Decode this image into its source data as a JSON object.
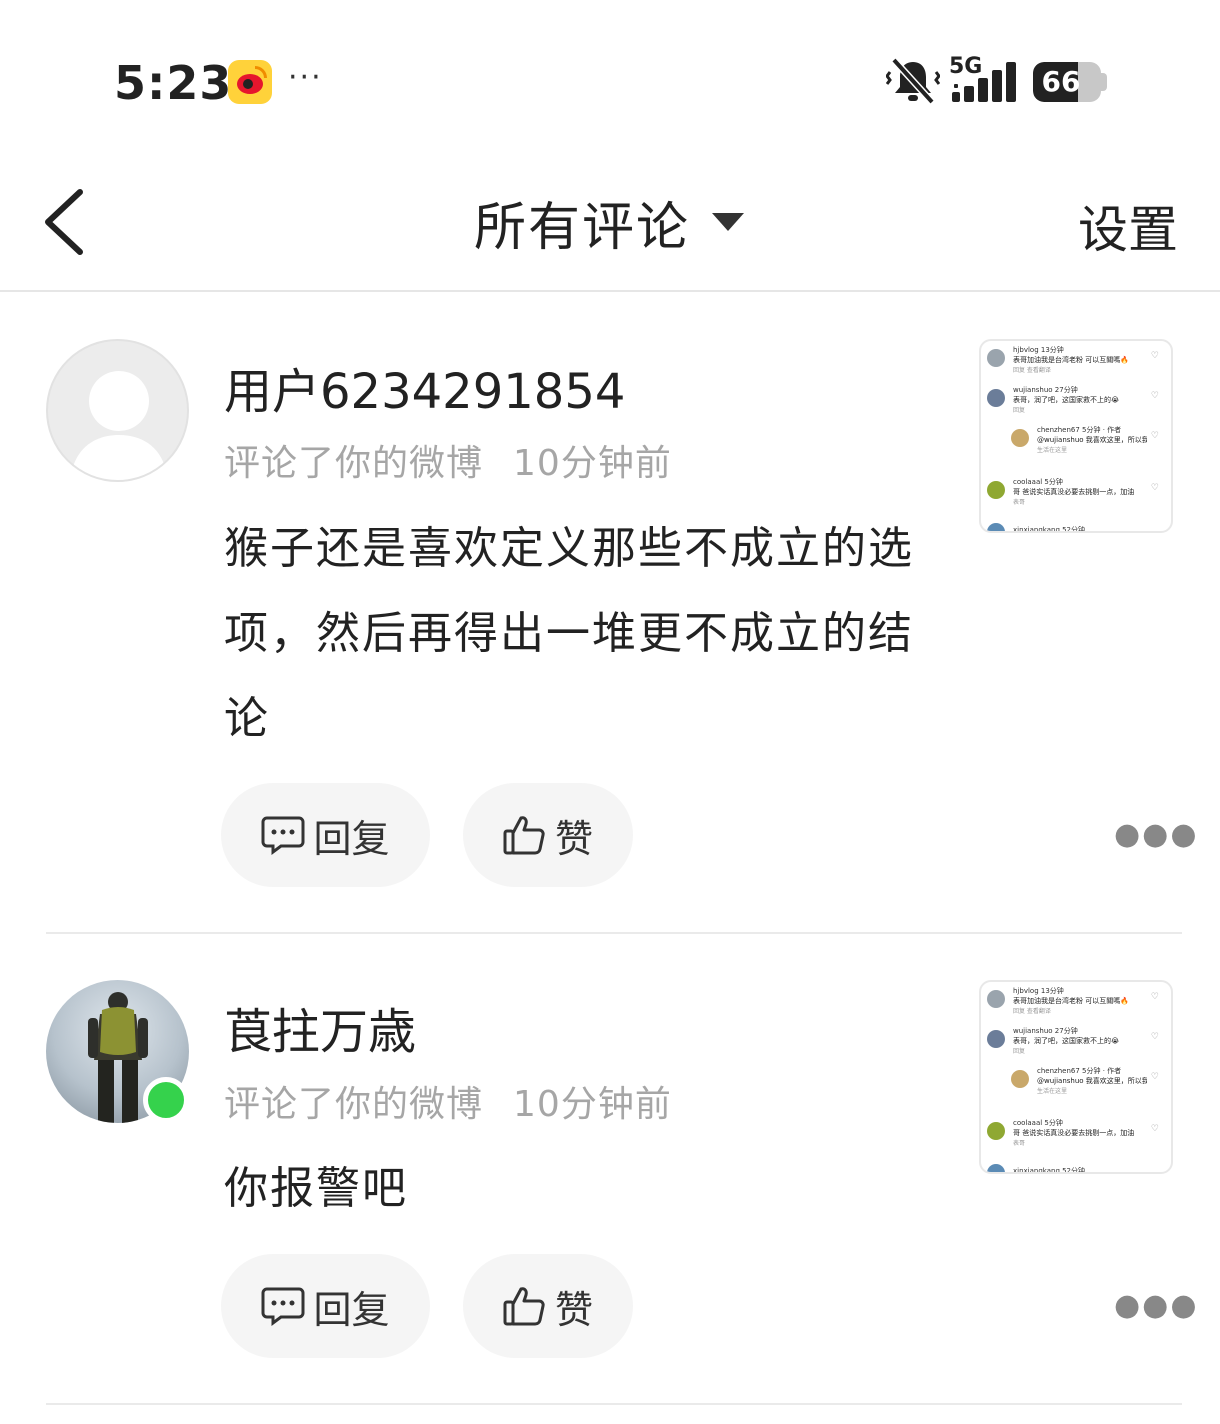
{
  "status_bar": {
    "time": "5:23",
    "more": "···",
    "network": "5G",
    "battery_level": 66,
    "battery_text": "66"
  },
  "nav": {
    "title": "所有评论",
    "settings": "设置"
  },
  "comments": [
    {
      "username": "用户6234291854",
      "action": "评论了你的微博",
      "time": "10分钟前",
      "text": "猴子还是喜欢定义那些不成立的选项，然后再得出一堆更不成立的结论",
      "reply_label": "回复",
      "like_label": "赞",
      "online": false
    },
    {
      "username": "莨拄万歳",
      "action": "评论了你的微博",
      "time": "10分钟前",
      "text": "你报警吧",
      "reply_label": "回复",
      "like_label": "赞",
      "online": true
    }
  ],
  "thumbnail": {
    "rows": [
      {
        "name": "hjbvlog  13分钟",
        "text": "表哥加油我是台湾老粉 可以互關嗎🔥",
        "sub": "回复    查看翻译",
        "reply": false
      },
      {
        "name": "wujianshuo  27分钟",
        "text": "表哥，润了吧，这国家救不上的😭",
        "sub": "回复",
        "reply": false
      },
      {
        "name": "chenzhen67  5分钟 · 作者",
        "text": "@wujianshuo 我喜欢这里，所以我",
        "sub": "生活在这里",
        "reply": true
      },
      {
        "name": "coolaaal  5分钟",
        "text": "哥 爸说实话真没必要去挑剔一点，加油",
        "sub": "表哥",
        "reply": false
      },
      {
        "name": "xinxiangkang  52分钟",
        "text": "",
        "sub": "",
        "reply": false
      }
    ]
  },
  "colors": {
    "meta_gray": "#a6a6a6",
    "button_bg": "#f5f5f5",
    "online_green": "#35d24c",
    "weibo_red": "#e6162d",
    "weibo_yellow": "#ffd23a"
  }
}
